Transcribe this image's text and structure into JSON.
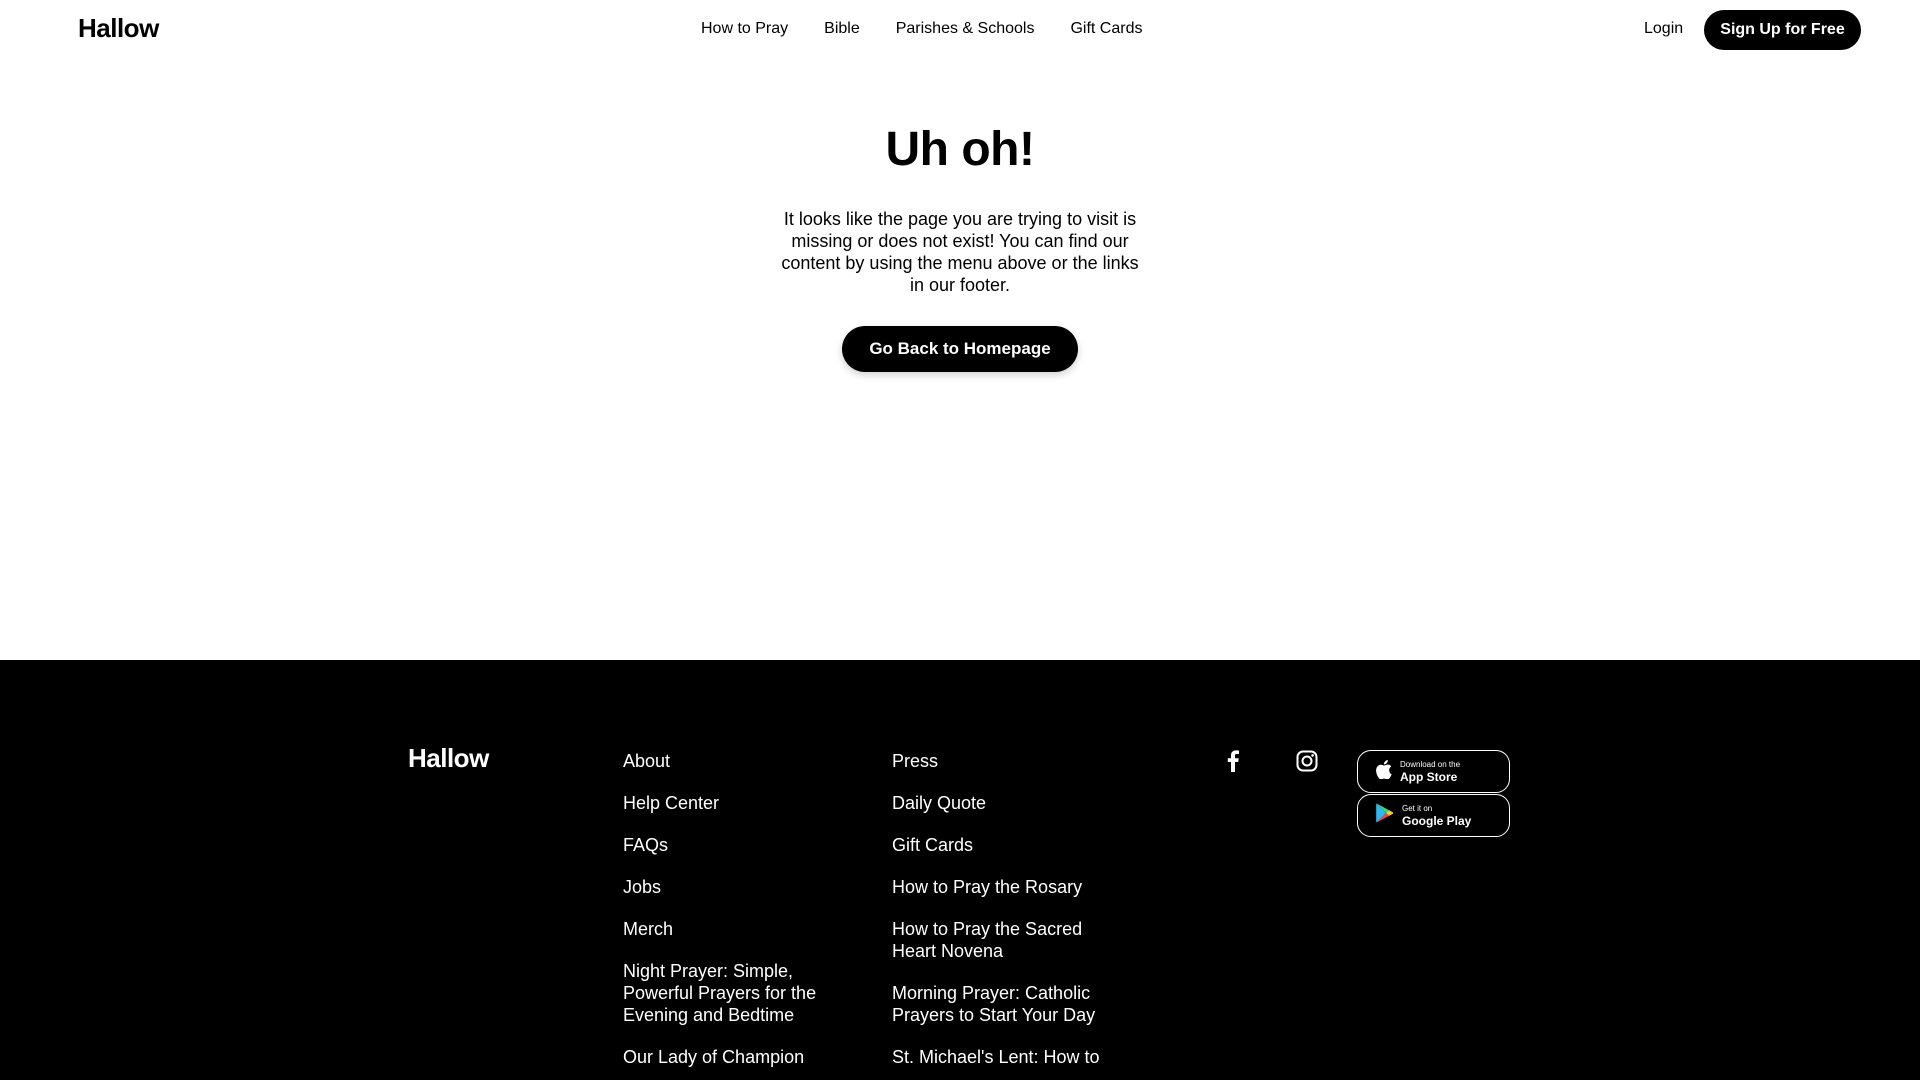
{
  "header": {
    "logo": "Hallow",
    "nav": [
      "How to Pray",
      "Bible",
      "Parishes & Schools",
      "Gift Cards"
    ],
    "login": "Login",
    "signup": "Sign Up for Free"
  },
  "main": {
    "title": "Uh oh!",
    "message": "It looks like the page you are trying to visit is missing or does not exist! You can find our content by using the menu above or the links in our footer.",
    "button": "Go Back to Homepage"
  },
  "footer": {
    "logo": "Hallow",
    "col1": [
      "About",
      "Help Center",
      "FAQs",
      "Jobs",
      "Merch",
      "Night Prayer: Simple, Powerful Prayers for the Evening and Bedtime",
      "Our Lady of Champion"
    ],
    "col2": [
      "Press",
      "Daily Quote",
      "Gift Cards",
      "How to Pray the Rosary",
      "How to Pray the Sacred Heart Novena",
      "Morning Prayer: Catholic Prayers to Start Your Day",
      "St. Michael's Lent: How to"
    ],
    "app_store": {
      "small": "Download on the",
      "big": "App Store"
    },
    "google_play": {
      "small": "Get it on",
      "big": "Google Play"
    }
  },
  "icons": {
    "facebook": "facebook-icon",
    "instagram": "instagram-icon",
    "apple": "apple-icon",
    "google_play": "google-play-icon"
  },
  "colors": {
    "primary": "#000000",
    "background": "#ffffff"
  }
}
